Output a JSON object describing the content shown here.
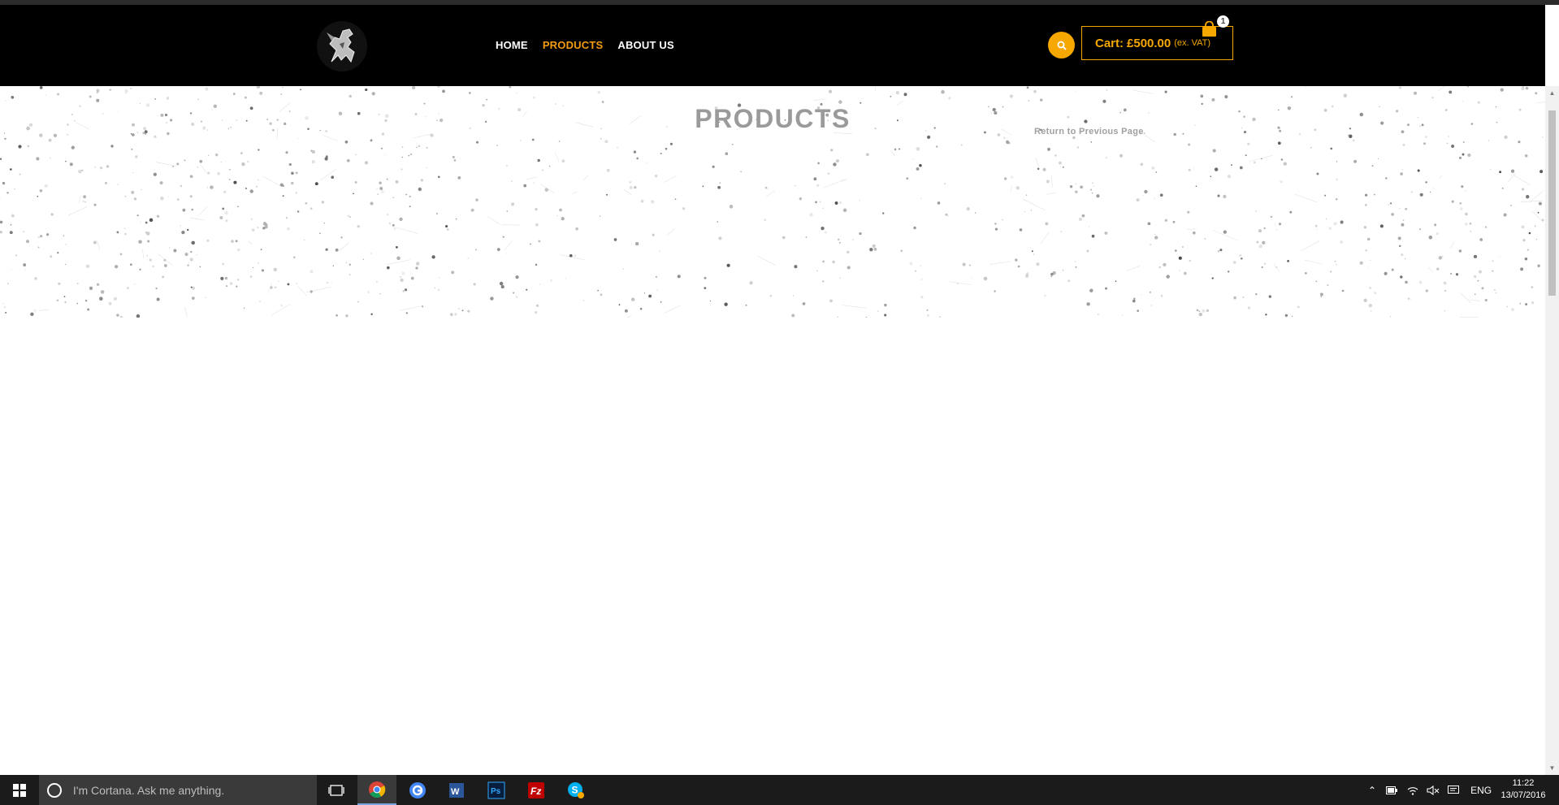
{
  "header": {
    "logo_alt": "griffin-logo",
    "nav": [
      {
        "label": "HOME",
        "active": false
      },
      {
        "label": "PRODUCTS",
        "active": true
      },
      {
        "label": "ABOUT US",
        "active": false
      }
    ],
    "cart": {
      "label": "Cart:",
      "amount": "£500.00",
      "vat_note": "(ex. VAT)",
      "item_count": "1"
    },
    "accent_color": "#f7a800"
  },
  "band": {
    "title": "PRODUCTS",
    "return_link": "Return to Previous Page"
  },
  "taskbar": {
    "cortana_placeholder": "I'm Cortana. Ask me anything.",
    "apps": [
      "task-view-icon",
      "chrome-icon",
      "google-icon",
      "word-icon",
      "photoshop-icon",
      "filezilla-icon",
      "skype-icon"
    ],
    "language": "ENG",
    "time": "11:22",
    "date": "13/07/2016"
  }
}
